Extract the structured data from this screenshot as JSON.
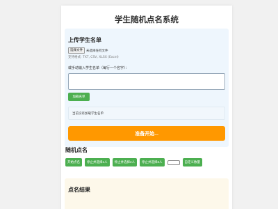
{
  "page": {
    "title": "学生随机点名系统"
  },
  "upload": {
    "title": "上传学生名单",
    "file_button": "选择文件",
    "file_status": "未选择任何文件",
    "hint": "支持格式: TXT, CSV, XLSX (Excel)",
    "manual_label": "或手动输入学生名单（每行一个名字）：",
    "textarea_value": "",
    "load_button": "加载名单",
    "status": "当前没有加载学生名单",
    "start_button": "准备开始..."
  },
  "roll_call": {
    "title": "随机点名",
    "buttons": [
      "开始点名",
      "停止并选择1人",
      "停止并选择2人",
      "停止并选择3人"
    ],
    "count_value": "",
    "custom_button": "自定义数量"
  },
  "result": {
    "title": "点名结果"
  },
  "colors": {
    "green": "#4caf50",
    "orange": "#ff9800",
    "upload_bg": "#eef6fd",
    "result_bg": "#fdf8ea"
  }
}
